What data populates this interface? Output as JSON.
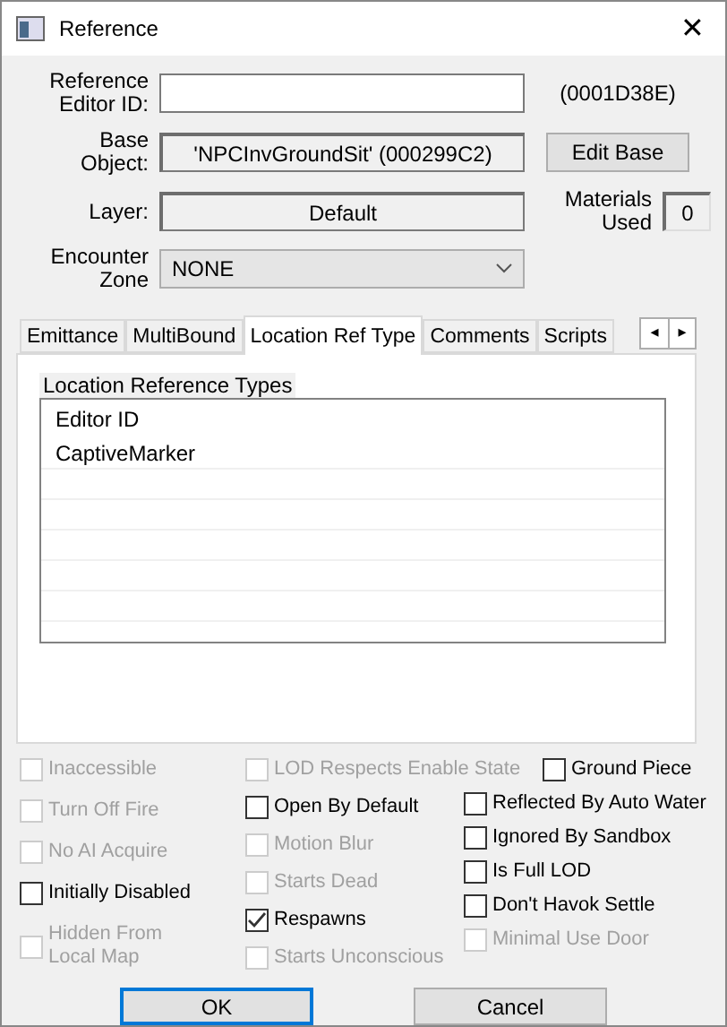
{
  "window": {
    "title": "Reference",
    "close": "✕"
  },
  "form": {
    "editor_id_label": "Reference Editor ID:",
    "form_id": "(0001D38E)",
    "base_object_label": "Base Object:",
    "base_object": "'NPCInvGroundSit' (000299C2)",
    "edit_base_button": "Edit Base",
    "layer_label": "Layer:",
    "layer": "Default",
    "materials_label": "Materials Used",
    "materials_used": "0",
    "encounter_zone_label": "Encounter Zone",
    "encounter_zone": "NONE"
  },
  "tabs": [
    {
      "label": "Emittance",
      "selected": false
    },
    {
      "label": "MultiBound",
      "selected": false
    },
    {
      "label": "Location Ref Type",
      "selected": true
    },
    {
      "label": "Comments",
      "selected": false
    },
    {
      "label": "Scripts",
      "selected": false
    }
  ],
  "tab_scroll": [
    "◂",
    "▸"
  ],
  "location_ref": {
    "group_label": "Location Reference Types",
    "column_header": "Editor ID",
    "rows": [
      "CaptiveMarker"
    ]
  },
  "flag_columns": [
    [
      {
        "label": "Inaccessible",
        "checked": false,
        "disabled": true
      },
      {
        "label": "Turn Off Fire",
        "checked": false,
        "disabled": true
      },
      {
        "label": "No AI Acquire",
        "checked": false,
        "disabled": true
      },
      {
        "label": "Initially Disabled",
        "checked": false,
        "disabled": false
      },
      {
        "label": "Hidden From Local Map",
        "checked": false,
        "disabled": true
      }
    ],
    [
      {
        "label": "LOD Respects Enable State",
        "checked": false,
        "disabled": true
      },
      {
        "label": "Open By Default",
        "checked": false,
        "disabled": false
      },
      {
        "label": "Motion Blur",
        "checked": false,
        "disabled": true
      },
      {
        "label": "Starts Dead",
        "checked": false,
        "disabled": true
      },
      {
        "label": "Respawns",
        "checked": true,
        "disabled": false
      },
      {
        "label": "Starts Unconscious",
        "checked": false,
        "disabled": true
      }
    ],
    [
      {
        "label": "Ground Piece",
        "checked": false,
        "disabled": false
      },
      {
        "label": "Reflected By Auto Water",
        "checked": false,
        "disabled": false
      },
      {
        "label": "Ignored By Sandbox",
        "checked": false,
        "disabled": false
      },
      {
        "label": "Is Full LOD",
        "checked": false,
        "disabled": false
      },
      {
        "label": "Don't Havok Settle",
        "checked": false,
        "disabled": false
      },
      {
        "label": "Minimal Use Door",
        "checked": false,
        "disabled": true
      }
    ]
  ],
  "buttons": [
    {
      "label": "OK",
      "default": true
    },
    {
      "label": "Cancel",
      "default": false
    }
  ]
}
